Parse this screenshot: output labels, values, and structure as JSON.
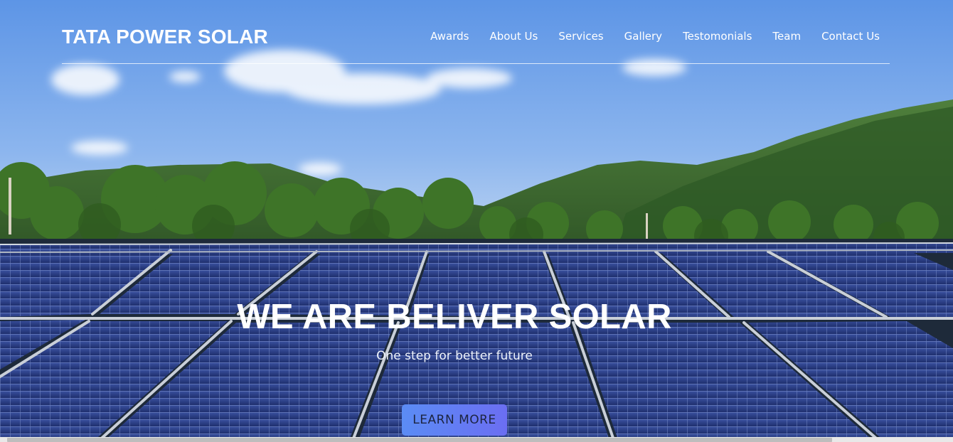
{
  "navbar": {
    "brand": "TATA POWER SOLAR",
    "items": [
      {
        "id": "awards",
        "label": "Awards"
      },
      {
        "id": "about",
        "label": "About Us"
      },
      {
        "id": "services",
        "label": "Services"
      },
      {
        "id": "gallery",
        "label": "Gallery"
      },
      {
        "id": "testimonials",
        "label": "Testomonials"
      },
      {
        "id": "team",
        "label": "Team"
      },
      {
        "id": "contact",
        "label": "Contact Us"
      }
    ]
  },
  "hero": {
    "title": "WE ARE BELIVER SOLAR",
    "subtitle": "One step for better future",
    "cta_label": "LEARN MORE"
  },
  "colors": {
    "sky_top": "#5d95e6",
    "sky_bottom": "#b6d0f0",
    "mountain": "#3f6e34",
    "trees": "#3e7428",
    "panel": "#2b3f86",
    "panel_frame": "#c9cfd8",
    "cta_start": "#5b8cf5",
    "cta_end": "#6b6ef2"
  },
  "scrollbar": {
    "orientation": "horizontal"
  }
}
